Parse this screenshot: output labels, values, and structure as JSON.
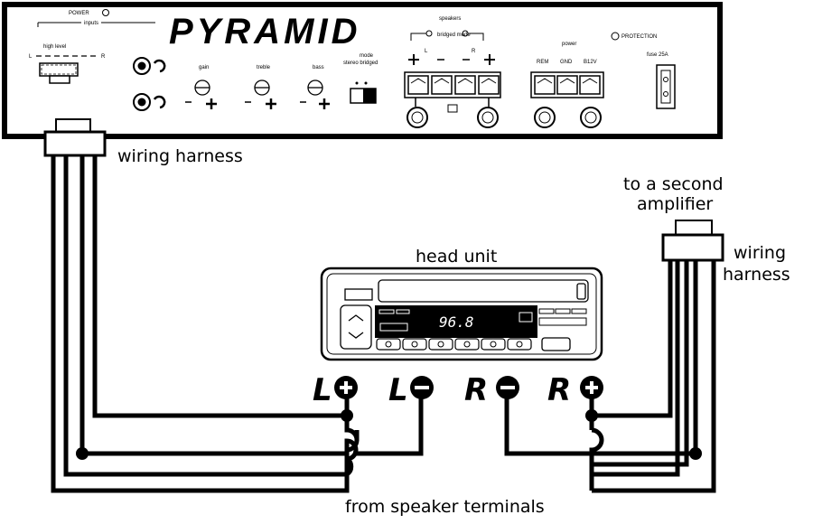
{
  "amplifier": {
    "brand": "PYRAMID",
    "power_label": "POWER",
    "inputs_label": "inputs",
    "highlevel_label": "high level",
    "highlevel_l": "L",
    "highlevel_r": "R",
    "gain_label": "gain",
    "treble_label": "treble",
    "bass_label": "bass",
    "mode_label": "mode",
    "mode_options": "stereo bridged",
    "speakers_label": "speakers",
    "bridged_mode_label": "bridged mode",
    "spk_l": "L",
    "spk_r": "R",
    "power_section_label": "power",
    "rem_label": "REM",
    "gnd_label": "GND",
    "b12_label": "B12V",
    "protection_label": "PROTECTION",
    "fuse_label": "fuse 25A"
  },
  "head_unit": {
    "label": "head unit",
    "display_value": "96.8"
  },
  "labels": {
    "wiring_harness_left": "wiring harness",
    "second_amp_line1": "to a second",
    "second_amp_line2": "amplifier",
    "wiring_harness_right_line1": "wiring",
    "wiring_harness_right_line2": "harness",
    "from_speakers": "from speaker terminals"
  },
  "terminals": {
    "left_pos": "L",
    "left_neg": "L",
    "right_neg": "R",
    "right_pos": "R"
  }
}
